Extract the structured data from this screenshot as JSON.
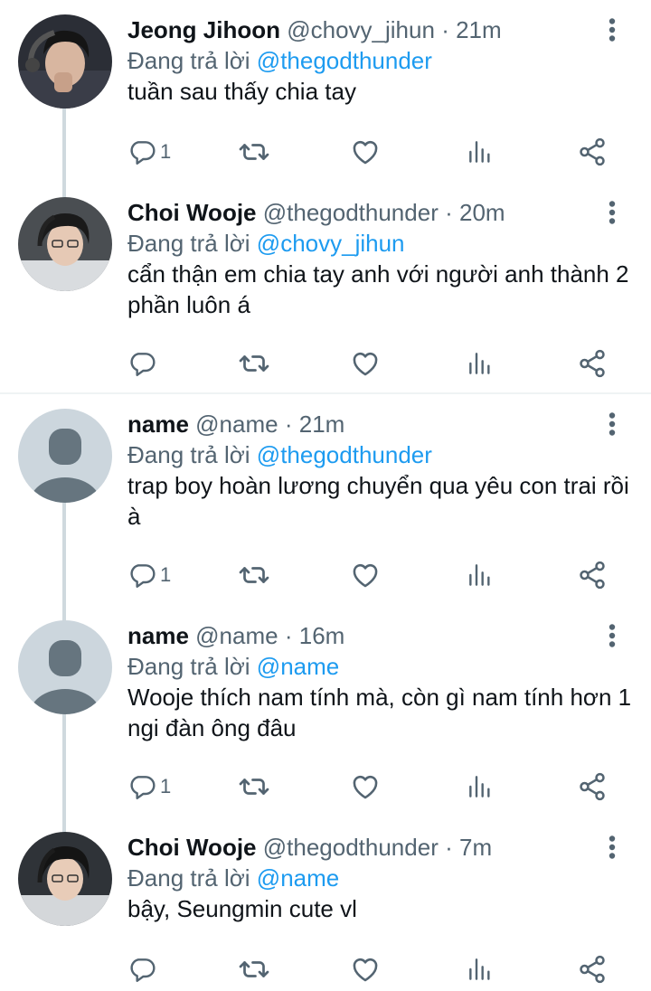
{
  "tweets": [
    {
      "name": "Jeong Jihoon",
      "handle": "@chovy_jihun",
      "separator": "·",
      "time": "21m",
      "replying_prefix": "Đang trả lời",
      "replying_to": "@thegodthunder",
      "text": "tuần sau thấy chia tay",
      "reply_count": "1"
    },
    {
      "name": "Choi Wooje",
      "handle": "@thegodthunder",
      "separator": "·",
      "time": "20m",
      "replying_prefix": "Đang trả lời",
      "replying_to": "@chovy_jihun",
      "text": "cẩn thận em chia tay anh với người anh thành 2 phần luôn á",
      "reply_count": ""
    },
    {
      "name": "name",
      "handle": "@name",
      "separator": "·",
      "time": "21m",
      "replying_prefix": "Đang trả lời",
      "replying_to": "@thegodthunder",
      "text": "trap boy hoàn lương chuyển qua yêu con trai rồi à",
      "reply_count": "1"
    },
    {
      "name": "name",
      "handle": "@name",
      "separator": "·",
      "time": "16m",
      "replying_prefix": "Đang trả lời",
      "replying_to": "@name",
      "text": "Wooje thích nam tính mà, còn gì nam tính hơn 1 ngi đàn ông đâu",
      "reply_count": "1"
    },
    {
      "name": "Choi Wooje",
      "handle": "@thegodthunder",
      "separator": "·",
      "time": "7m",
      "replying_prefix": "Đang trả lời",
      "replying_to": "@name",
      "text": "bậy, Seungmin cute vl",
      "reply_count": ""
    }
  ],
  "icons": {
    "reply": "reply-icon",
    "retweet": "retweet-icon",
    "like": "heart-icon",
    "views": "analytics-icon",
    "share": "share-icon",
    "more": "more-vertical-icon"
  },
  "colors": {
    "name": "#0f1419",
    "secondary": "#536471",
    "mention": "#1d9bf0",
    "thread_line": "#cfd9de",
    "divider": "#eff3f4",
    "default_avatar_bg": "#ccd6dd",
    "default_avatar_fg": "#66757f"
  }
}
